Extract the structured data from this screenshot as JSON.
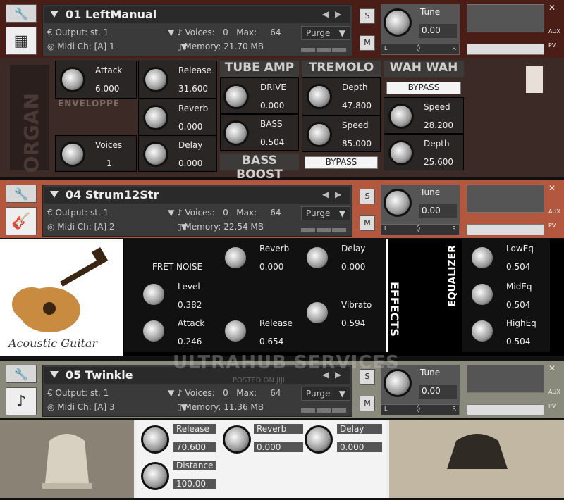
{
  "instruments": [
    {
      "name": "01 LeftManual",
      "output_label": "Output:",
      "output": "st. 1",
      "voices_label": "Voices:",
      "voices": "0",
      "max_label": "Max:",
      "max": "64",
      "purge": "Purge",
      "midi_label": "Midi Ch:",
      "midi": "[A]  1",
      "memory_label": "Memory:",
      "memory": "21.70 MB",
      "tune_label": "Tune",
      "tune": "0.00",
      "solo": "S",
      "mute": "M",
      "aux": "AUX",
      "pv": "PV",
      "pan_l": "L",
      "pan_r": "R"
    },
    {
      "name": "04 Strum12Str",
      "output_label": "Output:",
      "output": "st. 1",
      "voices_label": "Voices:",
      "voices": "0",
      "max_label": "Max:",
      "max": "64",
      "purge": "Purge",
      "midi_label": "Midi Ch:",
      "midi": "[A]  2",
      "memory_label": "Memory:",
      "memory": "22.54 MB",
      "tune_label": "Tune",
      "tune": "0.00",
      "solo": "S",
      "mute": "M",
      "aux": "AUX",
      "pv": "PV",
      "pan_l": "L",
      "pan_r": "R"
    },
    {
      "name": "05 Twinkle",
      "output_label": "Output:",
      "output": "st. 1",
      "voices_label": "Voices:",
      "voices": "0",
      "max_label": "Max:",
      "max": "64",
      "purge": "Purge",
      "midi_label": "Midi Ch:",
      "midi": "[A]  3",
      "memory_label": "Memory:",
      "memory": "11.36 MB",
      "tune_label": "Tune",
      "tune": "0.00",
      "solo": "S",
      "mute": "M",
      "aux": "AUX",
      "pv": "PV",
      "pan_l": "L",
      "pan_r": "R"
    }
  ],
  "organ": {
    "side_text": "ORGAN",
    "envelope": "ENVELOPPE",
    "attack_label": "Attack",
    "attack": "6.000",
    "release_label": "Release",
    "release": "31.600",
    "reverb_label": "Reverb",
    "reverb": "0.000",
    "delay_label": "Delay",
    "delay": "0.000",
    "voices_label": "Voices",
    "voices": "1",
    "tube_title": "TUBE AMP",
    "drive_label": "DRIVE",
    "drive": "0.000",
    "bass_label": "BASS",
    "bass": "0.504",
    "bass_boost": "BASS BOOST",
    "tremolo_title": "TREMOLO",
    "trem_depth_label": "Depth",
    "trem_depth": "47.800",
    "trem_speed_label": "Speed",
    "trem_speed": "85.000",
    "trem_bypass": "BYPASS",
    "wah_title": "WAH WAH",
    "wah_bypass": "BYPASS",
    "wah_speed_label": "Speed",
    "wah_speed": "28.200",
    "wah_depth_label": "Depth",
    "wah_depth": "25.600"
  },
  "guitar": {
    "logo": "Acoustic Guitar",
    "fret_noise": "FRET NOISE",
    "reverb_label": "Reverb",
    "reverb": "0.000",
    "delay_label": "Delay",
    "delay": "0.000",
    "level_label": "Level",
    "level": "0.382",
    "vibrato_label": "Vibrato",
    "vibrato": "0.594",
    "attack_label": "Attack",
    "attack": "0.246",
    "release_label": "Release",
    "release": "0.654",
    "effects": "EFFECTS",
    "equalizer": "EQUALIZER",
    "loweq_label": "LowEq",
    "loweq": "0.504",
    "mideq_label": "MidEq",
    "mideq": "0.504",
    "higheq_label": "HighEq",
    "higheq": "0.504"
  },
  "twinkle": {
    "release_label": "Release",
    "release": "70.600",
    "reverb_label": "Reverb",
    "reverb": "0.000",
    "delay_label": "Delay",
    "delay": "0.000",
    "distance_label": "Distance",
    "distance": "100.00"
  },
  "watermark": {
    "main": "ULTRAHUB SERVICES",
    "sub": "POSTED ON JIJI"
  }
}
